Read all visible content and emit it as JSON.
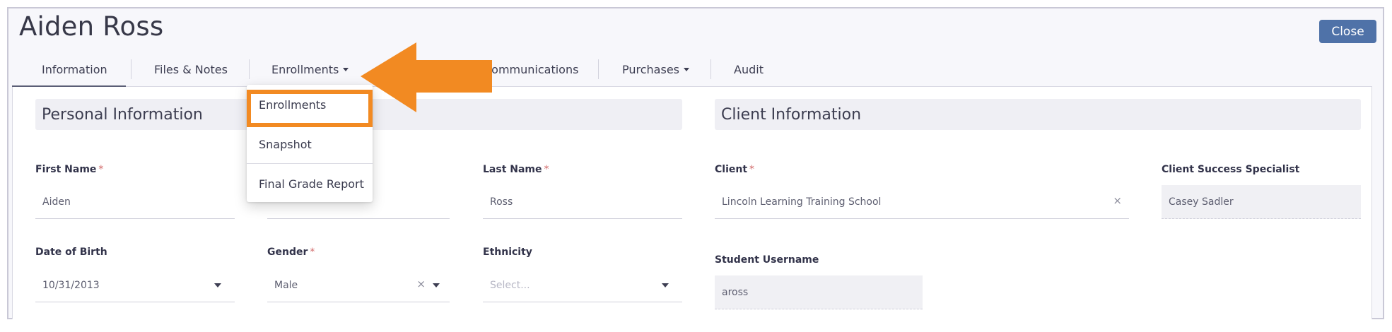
{
  "header": {
    "title": "Aiden Ross",
    "close_label": "Close"
  },
  "tabs": [
    {
      "label": "Information"
    },
    {
      "label": "Files & Notes"
    },
    {
      "label": "Enrollments"
    },
    {
      "label": "Communications"
    },
    {
      "label": "Purchases"
    },
    {
      "label": "Audit"
    }
  ],
  "enrollments_menu": {
    "items": [
      {
        "label": "Enrollments"
      },
      {
        "label": "Snapshot"
      },
      {
        "label": "Final Grade Report"
      }
    ]
  },
  "annotation": {
    "color": "#f28a22"
  },
  "personal_info": {
    "heading": "Personal Information",
    "first_name": {
      "label": "First Name",
      "value": "Aiden"
    },
    "last_name": {
      "label": "Last Name",
      "value": "Ross"
    },
    "dob": {
      "label": "Date of Birth",
      "value": "10/31/2013"
    },
    "gender": {
      "label": "Gender",
      "value": "Male"
    },
    "ethnicity": {
      "label": "Ethnicity",
      "placeholder": "Select..."
    },
    "required_mark": "*"
  },
  "client_info": {
    "heading": "Client Information",
    "client": {
      "label": "Client",
      "value": "Lincoln Learning Training School"
    },
    "css": {
      "label": "Client Success Specialist",
      "value": "Casey Sadler"
    },
    "username": {
      "label": "Student Username",
      "value": "aross"
    }
  },
  "icons": {
    "clear": "×"
  }
}
